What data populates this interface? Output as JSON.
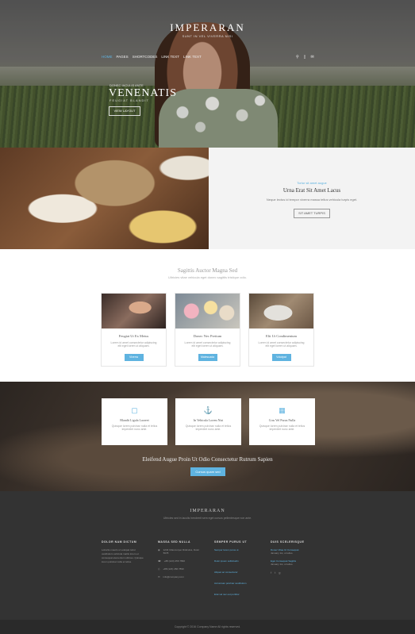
{
  "header": {
    "brand": "IMPERARAN",
    "tagline": "SUNT IN VEL VIVERRA NISI",
    "nav": [
      {
        "label": "HOME"
      },
      {
        "label": "PAGES"
      },
      {
        "label": "SHORTCODES"
      },
      {
        "label": "LINK TEXT"
      },
      {
        "label": "LINK TEXT"
      }
    ],
    "icons": [
      "search-icon",
      "cart-icon",
      "mail-icon"
    ]
  },
  "hero": {
    "kicker": "DONEC IACULIS ANTE",
    "title": "VENENATIS",
    "subtitle": "FEUGIAT BLANDIT",
    "button": "VIEW LAYOUT"
  },
  "feature": {
    "kicker": "Tortor sit amet augue",
    "title": "Urna Erat Sit Amet Lacus",
    "text": "Neque lectus id tempor viverra massa tellus vehicula turpis eget.",
    "button": "SIT AMET TURPIS"
  },
  "services": {
    "title": "Sagittis Auctor Magna Sed",
    "lead": "Ultricies vitae vehicula eget donec sagittis tristique odio.",
    "cards": [
      {
        "title": "Feugiat Ut Ex Metus",
        "text": "Lorem id amet consectetur adipiscing elit eget lorem ut aliquam.",
        "button": "Viverra"
      },
      {
        "title": "Donec Nec Pretium",
        "text": "Lorem id amet consectetur adipiscing elit eget lorem ut aliquam.",
        "button": "Malesuada"
      },
      {
        "title": "Elit Ut Condimentum",
        "text": "Lorem id amet consectetur adipiscing elit eget lorem ut aliquam.",
        "button": "Volutpat"
      }
    ]
  },
  "highlights": {
    "cards": [
      {
        "icon": "book-icon",
        "title": "Blandit Ligula Laoreet",
        "text": "Quisque lorem pulvinar nulla et tellus imperdiet nunc ante."
      },
      {
        "icon": "anchor-icon",
        "title": "In Vehicula Lorem Nisi",
        "text": "Quisque lorem pulvinar nulla et tellus imperdiet nunc ante."
      },
      {
        "icon": "bookmark-icon",
        "title": "Cras Vel Purus Nulla",
        "text": "Quisque lorem pulvinar nulla et tellus imperdiet nunc ante."
      }
    ],
    "headline": "Eleifend Augue Proin Ut Odio Consectetur Rutrum Sapien",
    "button": "Cursus quam sed"
  },
  "footer": {
    "brand": "IMPERARAN",
    "desc": "Ultricies sed in iaculis hendrerit sem eget cursus pellentesque non ante.",
    "columns": [
      {
        "title": "DOLOR NAM DICTUM",
        "text": "Lobortis mauris ut volutpat tortor vestibulum vehicula mattis lorem et consequat elementum ultrices. Quisque lorem pulvinar nulla et tellus."
      },
      {
        "title": "MASSA SED NULLA",
        "rows": [
          {
            "icon": "location-icon",
            "text": "1234 Ullamcorper Ridiculus, Dolor 5678"
          },
          {
            "icon": "phone-icon",
            "text": "+88 (123) 456 7890"
          },
          {
            "icon": "fax-icon",
            "text": "+88 (123) 456 7890"
          },
          {
            "icon": "mail-icon",
            "text": "info@company.com"
          }
        ]
      },
      {
        "title": "SEMPER PURUS UT",
        "links": [
          "Semper lorem purus ut",
          "Dolor ipsum sollicitudin",
          "Aliquet ac consectetur",
          "Accumsan pulvinar vestibulum",
          "Erat vel nec est porttitor"
        ]
      },
      {
        "title": "DUIS SCELERISQUE",
        "news": [
          {
            "title": "Donec Vitae Ut Consequat",
            "date": "January 1st, ut tellus."
          },
          {
            "title": "Eget Consequat Sagittis",
            "date": "January 1st, ut tellus."
          }
        ],
        "social": [
          "facebook-icon",
          "twitter-icon",
          "google-icon"
        ]
      }
    ]
  },
  "copyright": "Copyright © 2016 Company Name All rights reserved."
}
